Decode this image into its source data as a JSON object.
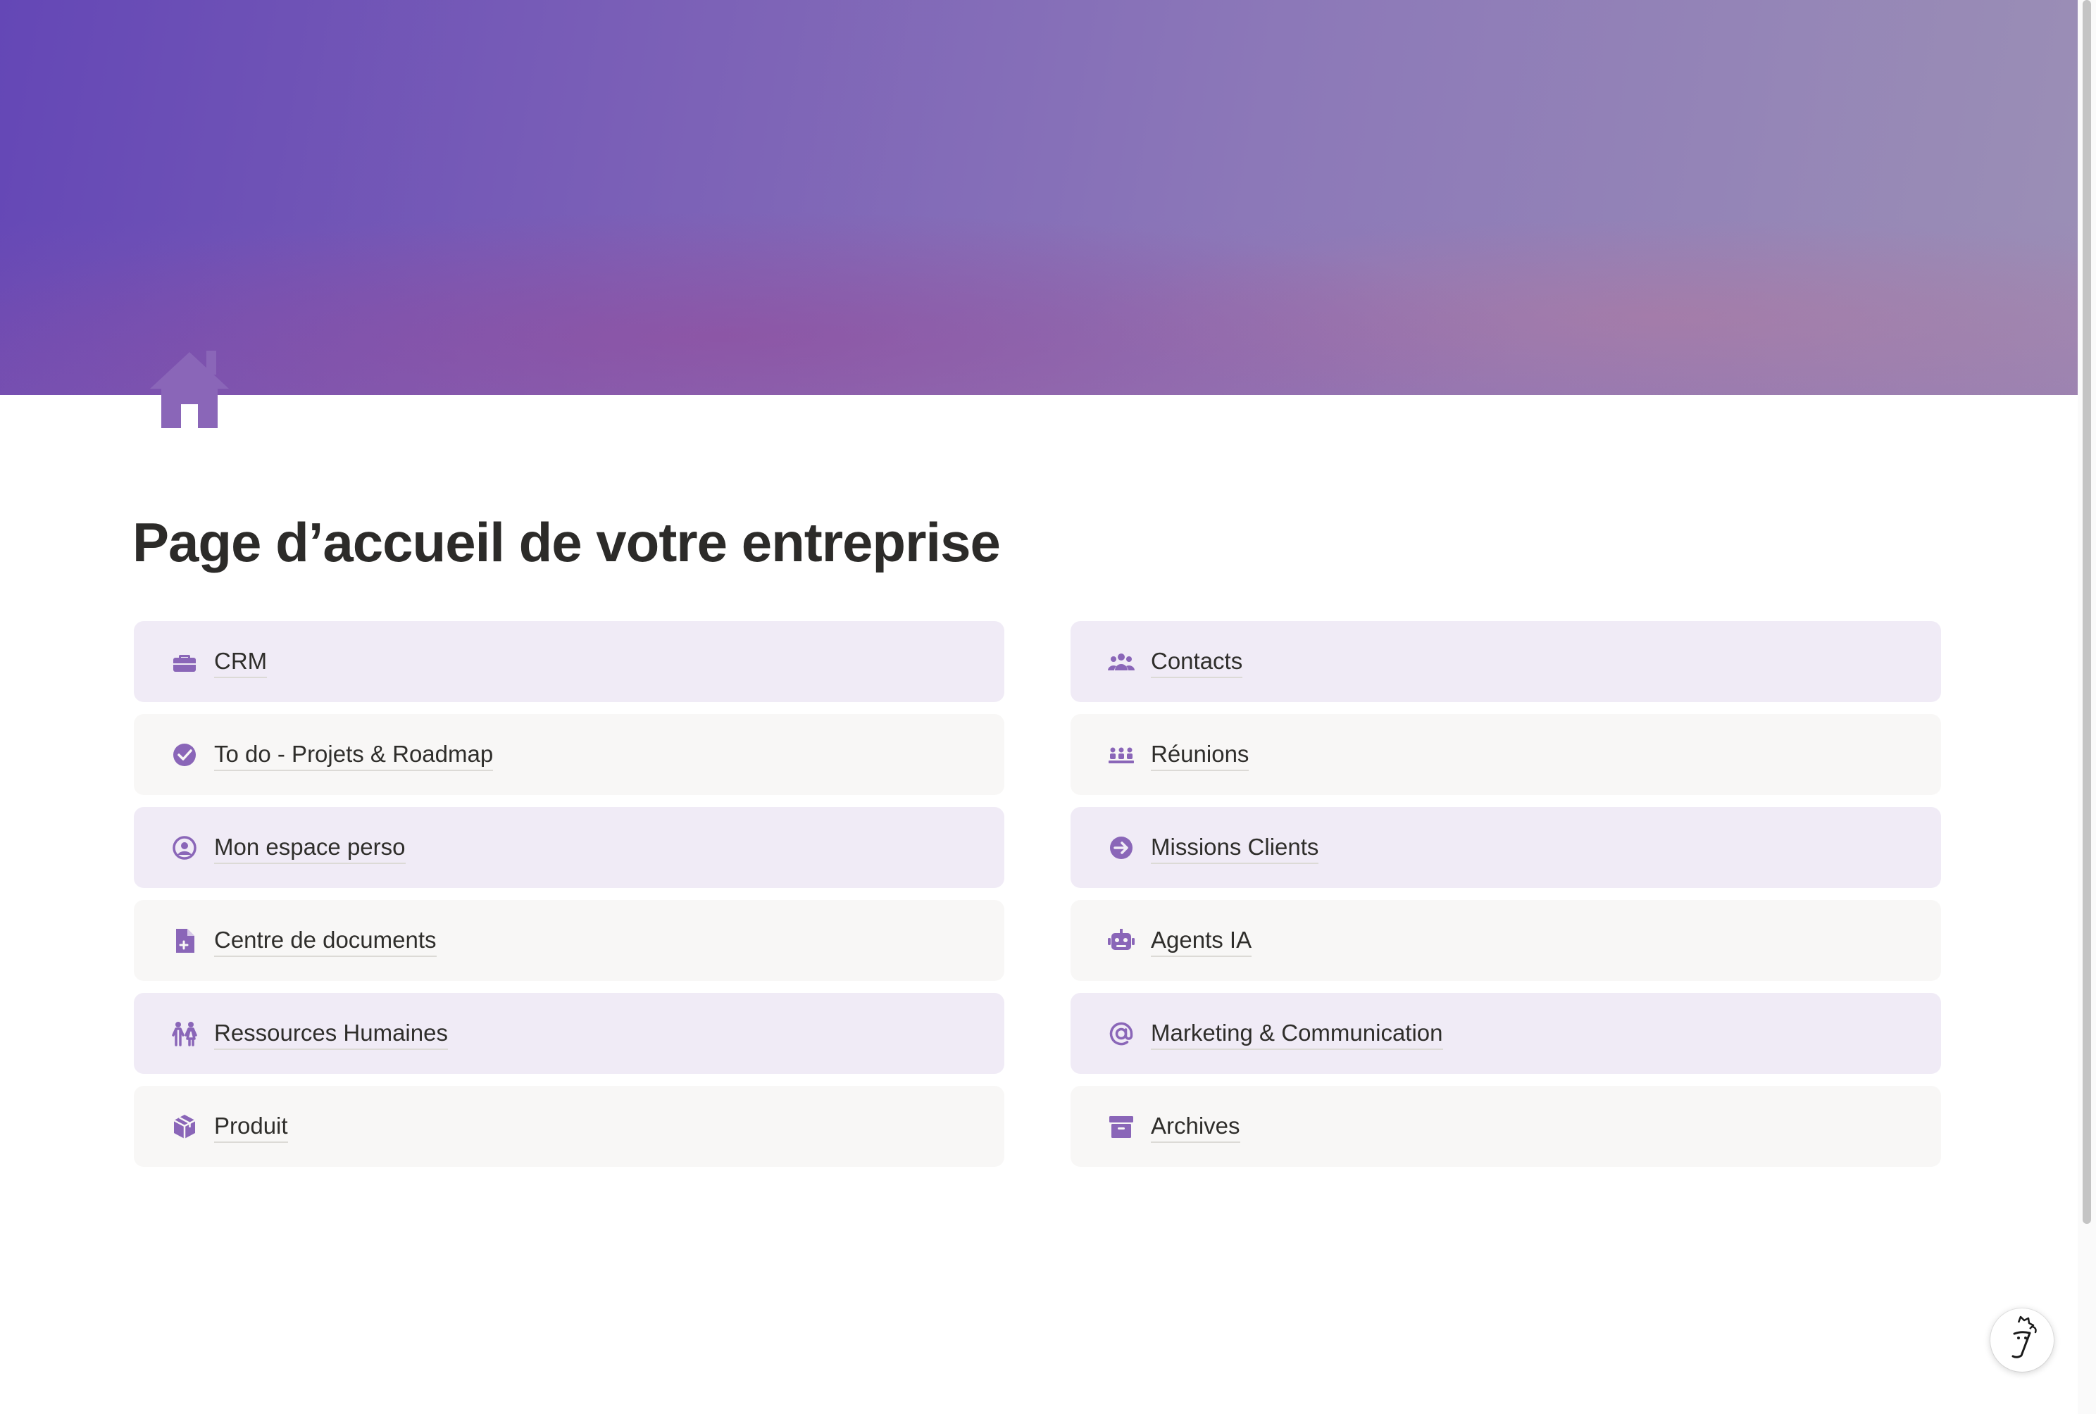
{
  "page": {
    "title": "Page d’accueil de votre entreprise",
    "icon": "house-icon",
    "cover": "purple-gradient-cover"
  },
  "links": [
    {
      "label": "CRM",
      "icon": "briefcase-icon",
      "style": "tinted"
    },
    {
      "label": "Contacts",
      "icon": "people-group-icon",
      "style": "tinted"
    },
    {
      "label": "To do - Projets & Roadmap",
      "icon": "check-circle-icon",
      "style": "plain"
    },
    {
      "label": "Réunions",
      "icon": "meeting-people-icon",
      "style": "plain"
    },
    {
      "label": "Mon espace perso",
      "icon": "user-circle-icon",
      "style": "tinted"
    },
    {
      "label": "Missions Clients",
      "icon": "arrow-circle-right-icon",
      "style": "tinted"
    },
    {
      "label": "Centre de documents",
      "icon": "document-add-icon",
      "style": "plain"
    },
    {
      "label": "Agents IA",
      "icon": "robot-icon",
      "style": "plain"
    },
    {
      "label": "Ressources Humaines",
      "icon": "person-pair-icon",
      "style": "tinted"
    },
    {
      "label": "Marketing & Communication",
      "icon": "at-sign-icon",
      "style": "tinted"
    },
    {
      "label": "Produit",
      "icon": "cube-icon",
      "style": "plain"
    },
    {
      "label": "Archives",
      "icon": "archive-box-icon",
      "style": "plain"
    }
  ],
  "colors": {
    "accent": "#8a66b8",
    "tinted_card": "#f0ebf6",
    "plain_card": "#f8f7f6",
    "title": "#2c2b29"
  },
  "assistant": {
    "icon": "ai-assistant-face-icon"
  }
}
